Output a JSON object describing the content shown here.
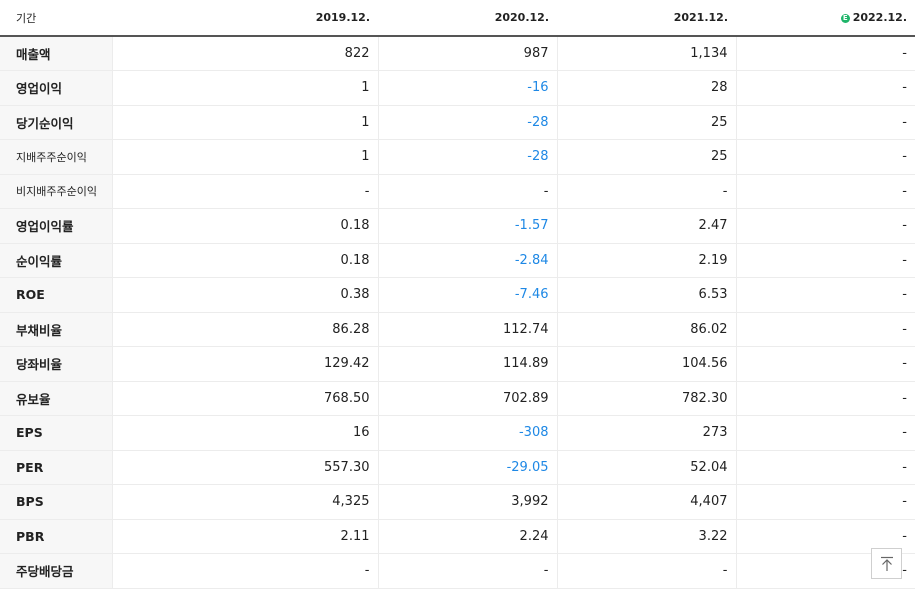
{
  "header": {
    "period_label": "기간",
    "years": [
      "2019.12.",
      "2020.12.",
      "2021.12.",
      "2022.12."
    ],
    "estimate_icon": "estimate-badge-icon",
    "estimate_letter": "E"
  },
  "rows": [
    {
      "label": "매출액",
      "values": [
        "822",
        "987",
        "1,134",
        "-"
      ]
    },
    {
      "label": "영업이익",
      "values": [
        "1",
        "-16",
        "28",
        "-"
      ]
    },
    {
      "label": "당기순이익",
      "values": [
        "1",
        "-28",
        "25",
        "-"
      ]
    },
    {
      "label": "지배주주순이익",
      "values": [
        "1",
        "-28",
        "25",
        "-"
      ]
    },
    {
      "label": "비지배주주순이익",
      "values": [
        "-",
        "-",
        "-",
        "-"
      ]
    },
    {
      "label": "영업이익률",
      "values": [
        "0.18",
        "-1.57",
        "2.47",
        "-"
      ]
    },
    {
      "label": "순이익률",
      "values": [
        "0.18",
        "-2.84",
        "2.19",
        "-"
      ]
    },
    {
      "label": "ROE",
      "values": [
        "0.38",
        "-7.46",
        "6.53",
        "-"
      ]
    },
    {
      "label": "부채비율",
      "values": [
        "86.28",
        "112.74",
        "86.02",
        "-"
      ]
    },
    {
      "label": "당좌비율",
      "values": [
        "129.42",
        "114.89",
        "104.56",
        "-"
      ]
    },
    {
      "label": "유보율",
      "values": [
        "768.50",
        "702.89",
        "782.30",
        "-"
      ]
    },
    {
      "label": "EPS",
      "values": [
        "16",
        "-308",
        "273",
        "-"
      ]
    },
    {
      "label": "PER",
      "values": [
        "557.30",
        "-29.05",
        "52.04",
        "-"
      ]
    },
    {
      "label": "BPS",
      "values": [
        "4,325",
        "3,992",
        "4,407",
        "-"
      ]
    },
    {
      "label": "PBR",
      "values": [
        "2.11",
        "2.24",
        "3.22",
        "-"
      ]
    },
    {
      "label": "주당배당금",
      "values": [
        "-",
        "-",
        "-",
        "-"
      ]
    }
  ],
  "scroll_top_icon": "arrow-up-to-top-icon",
  "colors": {
    "negative": "#1e88e5",
    "estimate": "#1fb56a"
  }
}
